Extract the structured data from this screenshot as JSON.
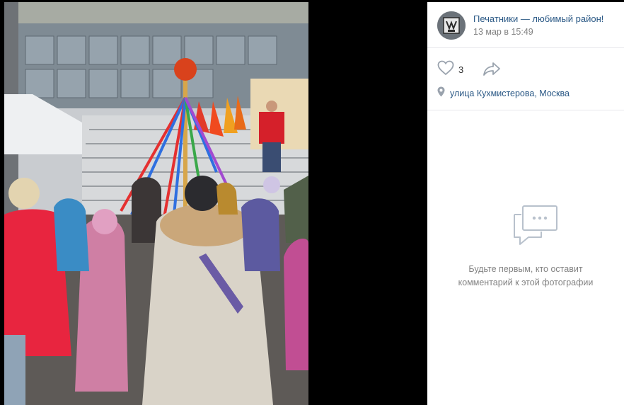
{
  "photo": {
    "alt_icon": "photo"
  },
  "author": {
    "name": "Печатники — любимый район!",
    "date": "13 мар в 15:49",
    "avatar_icon": "community-logo-icon"
  },
  "actions": {
    "like_count": "3",
    "like_icon": "heart-icon",
    "share_icon": "share-arrow-icon"
  },
  "location": {
    "icon": "map-pin-icon",
    "text": "улица Кухмистерова, Москва"
  },
  "comments": {
    "empty_icon": "comment-bubble-icon",
    "empty_line1": "Будьте первым, кто оставит",
    "empty_line2": "комментарий к этой фотографии"
  },
  "colors": {
    "link": "#2a5885",
    "muted": "#828282",
    "icon": "#99a2ad",
    "divider": "#e7e8ec"
  }
}
